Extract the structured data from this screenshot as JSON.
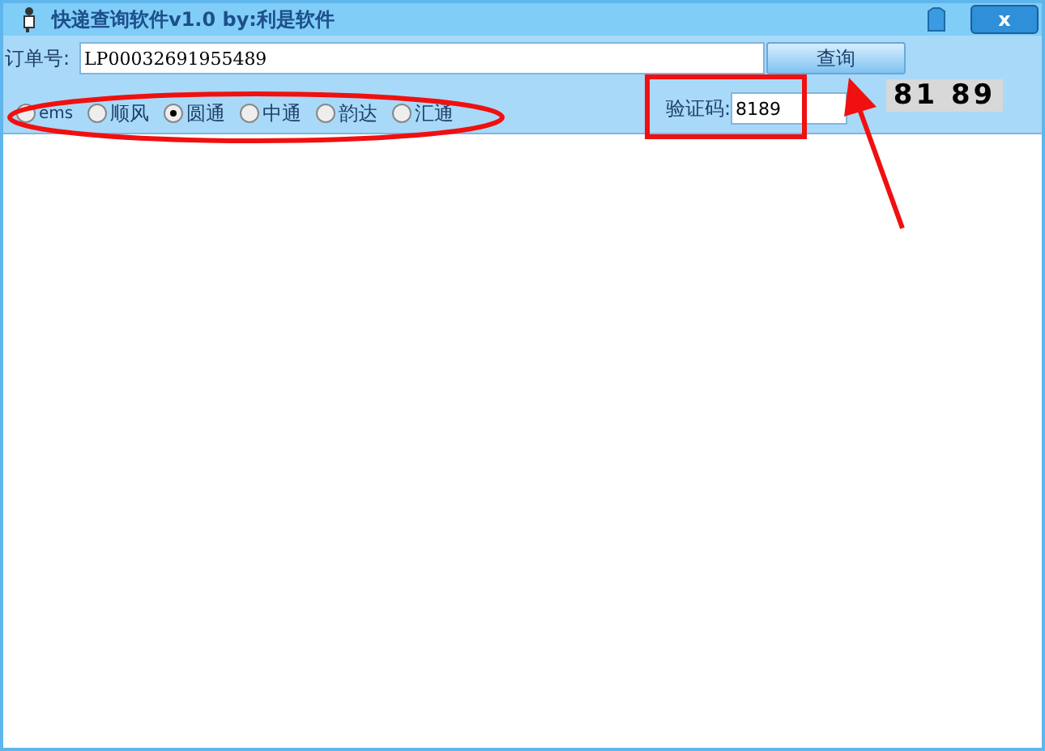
{
  "window": {
    "title": "快递查询软件v1.0  by:利是软件",
    "close": "x"
  },
  "order": {
    "label": "订单号:",
    "value": "LP00032691955489"
  },
  "query_button": "查询",
  "carriers": [
    {
      "label": "ems",
      "selected": false
    },
    {
      "label": "顺风",
      "selected": false
    },
    {
      "label": "圆通",
      "selected": true
    },
    {
      "label": "中通",
      "selected": false
    },
    {
      "label": "韵达",
      "selected": false
    },
    {
      "label": "汇通",
      "selected": false
    }
  ],
  "captcha": {
    "label": "验证码:",
    "value": "8189",
    "image_text": "81 89"
  }
}
